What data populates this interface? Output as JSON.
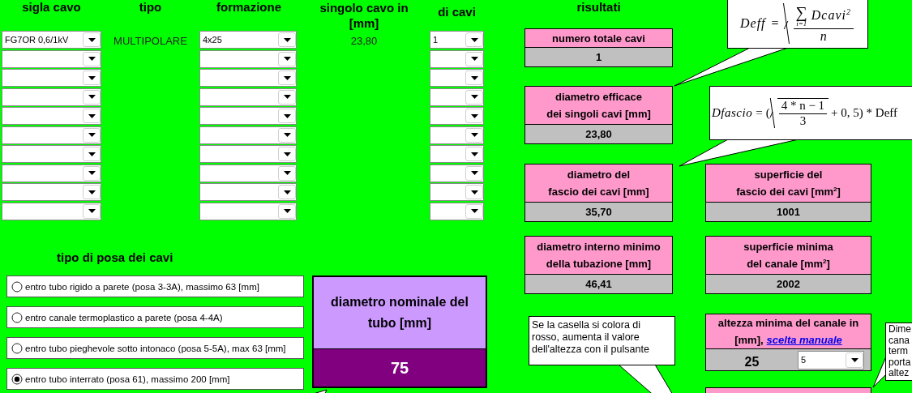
{
  "cable_table": {
    "columns": [
      "sigla cavo",
      "tipo",
      "formazione",
      "singolo cavo in\n[mm]",
      "di cavi"
    ],
    "rows": [
      {
        "sigla": "FG7OR 0,6/1kV",
        "tipo": "MULTIPOLARE",
        "formazione": "4x25",
        "diametro": "23,80",
        "numero": "1"
      },
      {},
      {},
      {},
      {},
      {},
      {},
      {},
      {},
      {}
    ]
  },
  "posa": {
    "title": "tipo di posa dei cavi",
    "options": [
      {
        "label": "entro tubo rigido a parete (posa 3-3A), massimo 63 [mm]",
        "selected": false
      },
      {
        "label": "entro canale termoplastico a parete (posa 4-4A)",
        "selected": false
      },
      {
        "label": "entro tubo pieghevole sotto intonaco (posa 5-5A), max 63 [mm]",
        "selected": false
      },
      {
        "label": "entro tubo interrato (posa 61), massimo 200 [mm]",
        "selected": true
      }
    ]
  },
  "nominal": {
    "title": "diametro nominale del\ntubo [mm]",
    "value": "75"
  },
  "results": {
    "title": "risultati",
    "rows": [
      {
        "left": {
          "kind": "value",
          "title": "numero totale cavi",
          "value": "1"
        }
      },
      {
        "left": {
          "kind": "value",
          "title": "diametro efficace\ndei singoli cavi [mm]",
          "value": "23,80"
        }
      },
      {
        "left": {
          "kind": "value",
          "title": "diametro del\nfascio dei cavi [mm]",
          "value": "35,70"
        },
        "right": {
          "kind": "value",
          "title": "superficie del\nfascio dei cavi [mm$^{2}$]",
          "value": "1001"
        }
      },
      {
        "left": {
          "kind": "value",
          "title": "diametro interno minimo\ndella tubazione [mm]",
          "value": "46,41"
        },
        "right": {
          "kind": "value",
          "title": "superficie minima\ndel canale [mm$^{2}$]",
          "value": "2002"
        }
      },
      {
        "right": {
          "kind": "choice",
          "title": "altezza minima del canale in\n[mm],",
          "link": "scelta manuale",
          "value": "25",
          "dropdown": "5"
        }
      },
      {
        "right": {
          "kind": "blank"
        }
      }
    ]
  },
  "notes": [
    {
      "kind": "sqrt_mean",
      "lhs": "Deff",
      "eq": "=",
      "sum": "∑",
      "sum_lower": "i=1",
      "term": "Dcavi",
      "exponent": "2",
      "denominator": "n"
    },
    {
      "kind": "bundle",
      "lhs": "Dfascio",
      "eq": "=",
      "open": "(",
      "numerator": "4 * n − 1",
      "denominator": "3",
      "rest": "+ 0, 5) * Deff"
    },
    {
      "kind": "text",
      "text": "Se la casella si colora di\nrosso, aumenta il valore\ndell'altezza con il pulsante"
    },
    {
      "kind": "text",
      "text": "Dime\ncana\nterm\nporta\naltez"
    },
    {
      "kind": "tail"
    }
  ]
}
